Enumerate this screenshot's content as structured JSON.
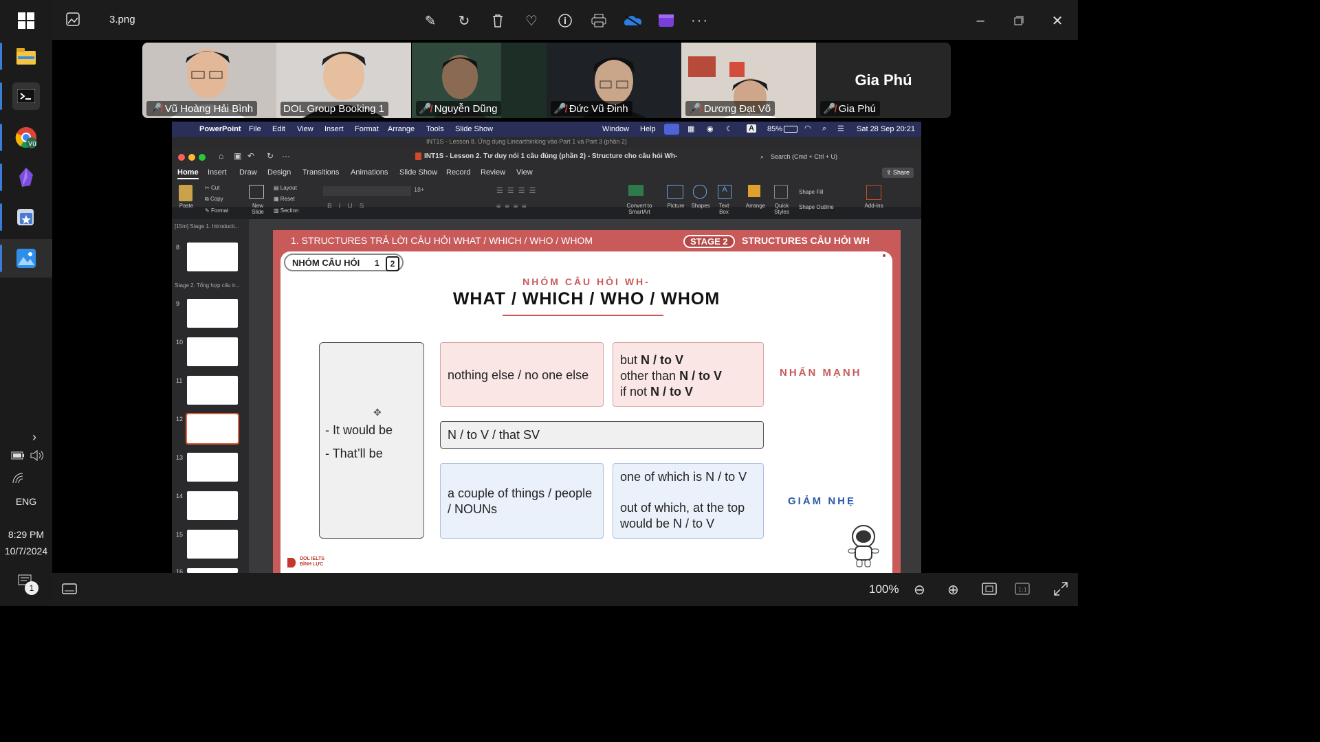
{
  "photos_app": {
    "file_name": "3.png",
    "zoom": "100%"
  },
  "taskbar": {
    "language": "ENG",
    "time": "8:29 PM",
    "date": "10/7/2024",
    "notification_count": "1"
  },
  "participants": [
    {
      "name": "Vũ Hoàng Hải Bình",
      "muted": true
    },
    {
      "name": "DOL Group Booking 1",
      "muted": false,
      "active_speaker": true
    },
    {
      "name": "Nguyễn Dũng",
      "muted": true
    },
    {
      "name": "Đức Vũ Đinh",
      "muted": true
    },
    {
      "name": "Dương Đạt Võ",
      "muted": true
    },
    {
      "name": "Gia Phú",
      "muted": true,
      "display_name": "Gia Phú"
    }
  ],
  "mac_menubar": {
    "app": "PowerPoint",
    "menus": [
      "File",
      "Edit",
      "View",
      "Insert",
      "Format",
      "Arrange",
      "Tools",
      "Slide Show"
    ],
    "right_menus": [
      "Window",
      "Help"
    ],
    "battery": "85%",
    "datetime": "Sat 28 Sep 20:21"
  },
  "powerpoint": {
    "back_title": "INT1S - Lesson 8. Ứng dụng Linearthinking vào Part 1 và Part 3 (phần 2)",
    "title": "INT1S - Lesson 2. Tư duy nói 1 câu đúng (phần 2) - Structure cho câu hỏi Wh-",
    "search_placeholder": "Search (Cmd + Ctrl + U)",
    "tabs": [
      "Home",
      "Insert",
      "Draw",
      "Design",
      "Transitions",
      "Animations",
      "Slide Show",
      "Record",
      "Review",
      "View"
    ],
    "share_label": "Share",
    "ribbon": {
      "paste": "Paste",
      "cut": "Cut",
      "copy": "Copy",
      "format": "Format",
      "new_slide": "New Slide",
      "layout": "Layout",
      "reset": "Reset",
      "section": "Section",
      "font_size": "18+",
      "convert": "Convert to SmartArt",
      "picture": "Picture",
      "shapes": "Shapes",
      "text_box": "Text Box",
      "arrange": "Arrange",
      "quick_styles": "Quick Styles",
      "shape_fill": "Shape Fill",
      "shape_outline": "Shape Outline",
      "add_ins": "Add-ins"
    },
    "sections": [
      {
        "label": "[15m] Stage 1. Introducti..."
      },
      {
        "label": "Stage 2. Tổng hợp cấu tr..."
      }
    ],
    "thumbnails": [
      "8",
      "9",
      "10",
      "11",
      "12",
      "13",
      "14",
      "15",
      "16"
    ],
    "selected_slide": "12"
  },
  "slide": {
    "header_left": "1. STRUCTURES TRẢ LỜI CÂU HỎI WHAT / WHICH / WHO / WHOM",
    "stage_badge": "STAGE 2",
    "header_right": "STRUCTURES CÂU HỎI WH",
    "group_label": "NHÓM CÂU HỎI",
    "group_num1": "1",
    "group_num2": "2",
    "subtitle": "NHÓM CÂU HỎI WH-",
    "title": "WHAT / WHICH / WHO / WHOM",
    "left_box": [
      "- It would be",
      "- That’ll be"
    ],
    "pink_box1": "nothing else / no one else",
    "pink_box2_lines": [
      {
        "pre": "but ",
        "bold": "N / to V",
        "post": ""
      },
      {
        "pre": "other than ",
        "bold": "N / to V",
        "post": ""
      },
      {
        "pre": "if not ",
        "bold": "N / to V",
        "post": ""
      }
    ],
    "middle_box": "N / to V / that SV",
    "blue_box1": "a couple of things / people / NOUNs",
    "blue_box2_line1": "one of which is N / to V",
    "blue_box2_line2": "out of which, at the top would be N / to V",
    "label_emphasis": "NHẤN MẠNH",
    "label_soften": "GIẢM NHẸ",
    "logo_line1": "DOL IELTS",
    "logo_line2": "ĐÌNH LỰC",
    "colors": {
      "emphasis": "#c0392b",
      "soften": "#2f5aa8",
      "frame": "#c85a5a"
    }
  }
}
